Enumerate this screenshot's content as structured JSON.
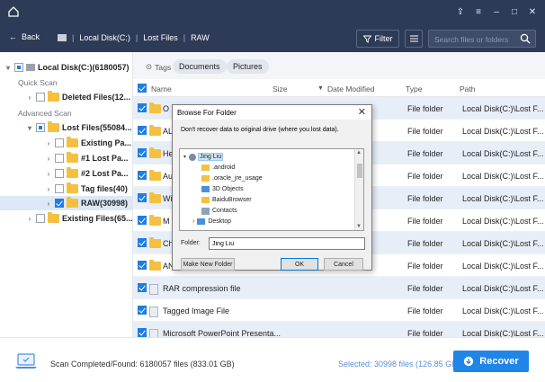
{
  "titlebar": {
    "icons": [
      "home-icon",
      "share-icon",
      "menu-icon",
      "minimize-icon",
      "maximize-icon",
      "close-icon"
    ]
  },
  "navbar": {
    "back_label": "Back",
    "crumbs": [
      "Local Disk(C:)",
      "Lost Files",
      "RAW"
    ],
    "filter_label": "Filter",
    "search_placeholder": "Search files or folders"
  },
  "sidebar": {
    "drive_label": "Local Disk(C:)(6180057)",
    "quick_scan_label": "Quick Scan",
    "deleted_files_label": "Deleted Files(12...",
    "advanced_scan_label": "Advanced Scan",
    "lost_files_label": "Lost Files(55084...",
    "existing_pa_label": "Existing Pa...",
    "lost_pa1_label": "#1 Lost Pa...",
    "lost_pa2_label": "#2 Lost Pa...",
    "tag_files_label": "Tag files(40)",
    "raw_label": "RAW(30998)",
    "existing_files_label": "Existing Files(65..."
  },
  "tags": {
    "label": "Tags",
    "chips": [
      "Documents",
      "Pictures"
    ]
  },
  "table": {
    "headers": {
      "name": "Name",
      "size": "Size",
      "date": "Date Modified",
      "type": "Type",
      "path": "Path"
    },
    "rows": [
      {
        "name": "O",
        "type": "File folder",
        "path": "Local Disk(C:)\\Lost F..."
      },
      {
        "name": "AL",
        "type": "File folder",
        "path": "Local Disk(C:)\\Lost F..."
      },
      {
        "name": "He",
        "type": "File folder",
        "path": "Local Disk(C:)\\Lost F..."
      },
      {
        "name": "Au",
        "type": "File folder",
        "path": "Local Disk(C:)\\Lost F..."
      },
      {
        "name": "Wi",
        "type": "File folder",
        "path": "Local Disk(C:)\\Lost F..."
      },
      {
        "name": "M",
        "type": "File folder",
        "path": "Local Disk(C:)\\Lost F..."
      },
      {
        "name": "Ch",
        "type": "File folder",
        "path": "Local Disk(C:)\\Lost F..."
      },
      {
        "name": "AN",
        "type": "File folder",
        "path": "Local Disk(C:)\\Lost F..."
      },
      {
        "name": "RAR compression file",
        "type": "File folder",
        "path": "Local Disk(C:)\\Lost F..."
      },
      {
        "name": "Tagged Image File",
        "type": "File folder",
        "path": "Local Disk(C:)\\Lost F..."
      },
      {
        "name": "Microsoft PowerPoint Presenta...",
        "type": "File folder",
        "path": "Local Disk(C:)\\Lost F..."
      }
    ]
  },
  "status": {
    "scan_text": "Scan Completed/Found: 6180057 files (833.01 GB)",
    "selected_text": "Selected: 30998 files (126.85 GB)",
    "recover_label": "Recover"
  },
  "dialog": {
    "title": "Browse For Folder",
    "message": "Don't recover data to original drive (where you lost data).",
    "tree": [
      "Jing Liu",
      ".android",
      ".oracle_jre_usage",
      "3D Objects",
      "BaiduBrowser",
      "Contacts",
      "Desktop"
    ],
    "folder_label": "Folder:",
    "folder_value": "Jing Liu",
    "new_folder_label": "Make New Folder",
    "ok_label": "OK",
    "cancel_label": "Cancel"
  }
}
